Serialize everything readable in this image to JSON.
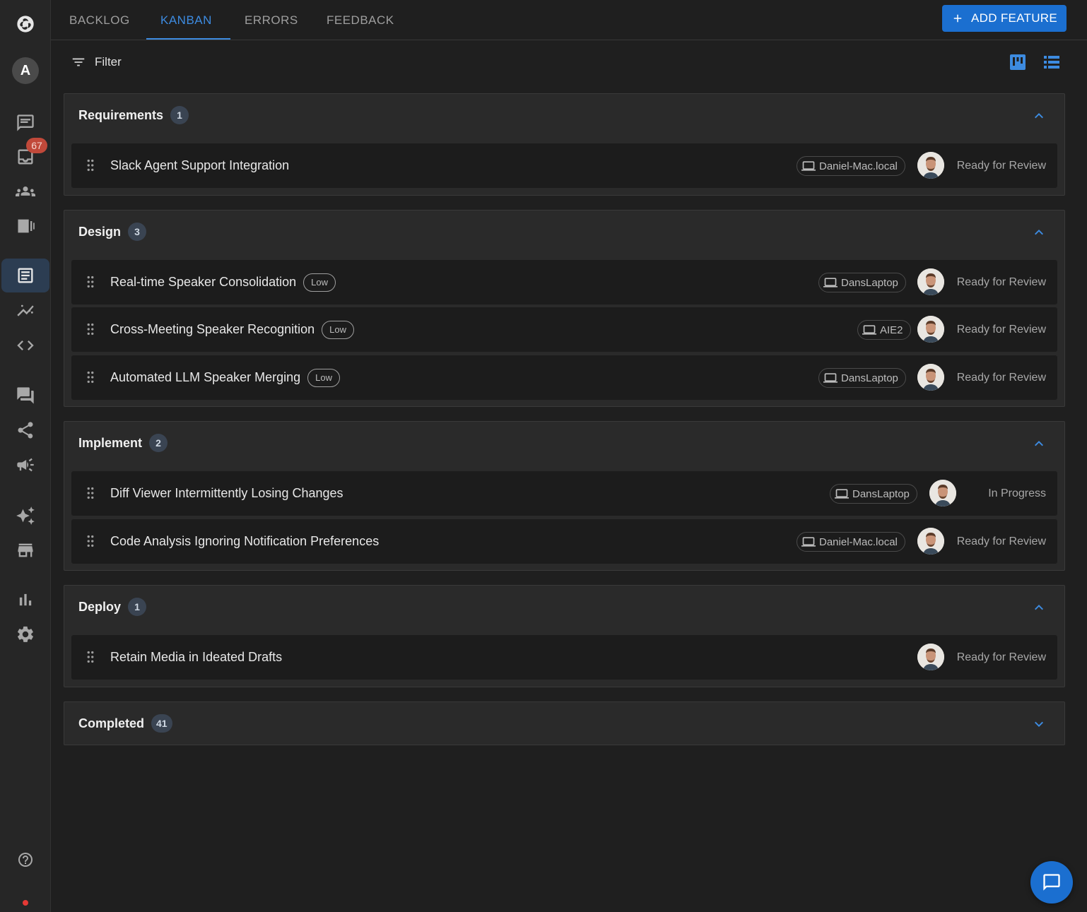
{
  "nav": {
    "tabs": [
      {
        "label": "BACKLOG"
      },
      {
        "label": "KANBAN",
        "active": true
      },
      {
        "label": "ERRORS"
      },
      {
        "label": "FEEDBACK"
      }
    ],
    "add_feature_label": "ADD FEATURE"
  },
  "sidebar": {
    "avatar_letter": "A",
    "inbox_badge": "67",
    "icons": [
      "logo-icon",
      "chat-icon",
      "inbox-icon",
      "team-icon",
      "panels-icon",
      "kanban-icon",
      "analytics-icon",
      "code-icon",
      "forum-icon",
      "share-icon",
      "megaphone-icon",
      "sparkles-icon",
      "store-icon",
      "bar-chart-icon",
      "settings-icon",
      "help-icon"
    ]
  },
  "filter": {
    "label": "Filter"
  },
  "sections": [
    {
      "title": "Requirements",
      "count": "1",
      "expanded": true,
      "items": [
        {
          "title": "Slack Agent Support Integration",
          "priority": "",
          "device": "Daniel-Mac.local",
          "status": "Ready for Review"
        }
      ]
    },
    {
      "title": "Design",
      "count": "3",
      "expanded": true,
      "items": [
        {
          "title": "Real-time Speaker Consolidation",
          "priority": "Low",
          "device": "DansLaptop",
          "status": "Ready for Review"
        },
        {
          "title": "Cross-Meeting Speaker Recognition",
          "priority": "Low",
          "device": "AIE2",
          "status": "Ready for Review"
        },
        {
          "title": "Automated LLM Speaker Merging",
          "priority": "Low",
          "device": "DansLaptop",
          "status": "Ready for Review"
        }
      ]
    },
    {
      "title": "Implement",
      "count": "2",
      "expanded": true,
      "items": [
        {
          "title": "Diff Viewer Intermittently Losing Changes",
          "priority": "",
          "device": "DansLaptop",
          "status": "In Progress"
        },
        {
          "title": "Code Analysis Ignoring Notification Preferences",
          "priority": "",
          "device": "Daniel-Mac.local",
          "status": "Ready for Review"
        }
      ]
    },
    {
      "title": "Deploy",
      "count": "1",
      "expanded": true,
      "items": [
        {
          "title": "Retain Media in Ideated Drafts",
          "priority": "",
          "device": "",
          "status": "Ready for Review"
        }
      ]
    },
    {
      "title": "Completed",
      "count": "41",
      "expanded": false,
      "items": []
    }
  ],
  "colors": {
    "accent": "#1b6fd0",
    "link": "#3d8be0",
    "badge": "#c1493a"
  }
}
